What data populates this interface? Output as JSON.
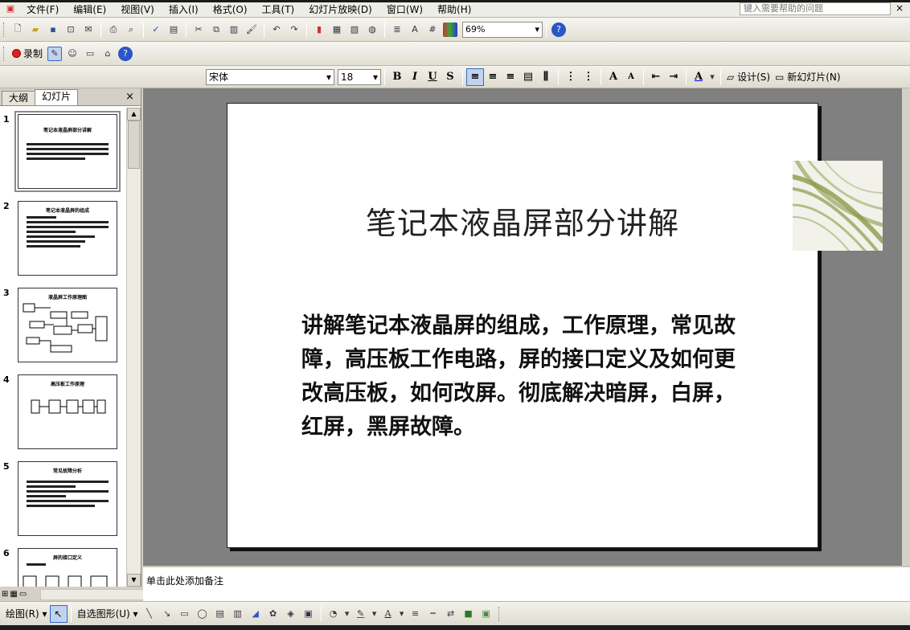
{
  "menubar": {
    "items": [
      "文件(F)",
      "编辑(E)",
      "视图(V)",
      "插入(I)",
      "格式(O)",
      "工具(T)",
      "幻灯片放映(D)",
      "窗口(W)",
      "帮助(H)"
    ],
    "help_placeholder": "键入需要帮助的问题",
    "close_glyph": "×"
  },
  "toolbar_standard": {
    "zoom": "69%"
  },
  "toolbar_review": {
    "record_label": "录制"
  },
  "toolbar_format": {
    "font_name": "宋体",
    "font_size": "18",
    "design_label": "设计(S)",
    "new_slide_label": "新幻灯片(N)"
  },
  "left_pane": {
    "tabs": [
      "大纲",
      "幻灯片"
    ],
    "close_glyph": "×",
    "slides": [
      {
        "number": "1",
        "title": "笔记本液晶屏部分讲解"
      },
      {
        "number": "2",
        "title": "笔记本液晶屏的组成"
      },
      {
        "number": "3",
        "title": "液晶屏工作原理图"
      },
      {
        "number": "4",
        "title": "高压板工作原理"
      },
      {
        "number": "5",
        "title": "常见故障分析"
      },
      {
        "number": "6",
        "title": "屏的接口定义"
      }
    ]
  },
  "slide": {
    "title": "笔记本液晶屏部分讲解",
    "body": "讲解笔记本液晶屏的组成，工作原理，常见故障，高压板工作电路，屏的接口定义及如何更改高压板，如何改屏。彻底解决暗屏，白屏，红屏，黑屏故障。"
  },
  "notes": {
    "placeholder": "单击此处添加备注"
  },
  "drawbar": {
    "draw_label": "绘图(R)",
    "autoshape_label": "自选图形(U)"
  },
  "colors": {
    "accent": "#316ac5",
    "toolbar_bg": "#e2dfd4",
    "workspace": "#808080",
    "deco_green": "#8a9a4a"
  }
}
